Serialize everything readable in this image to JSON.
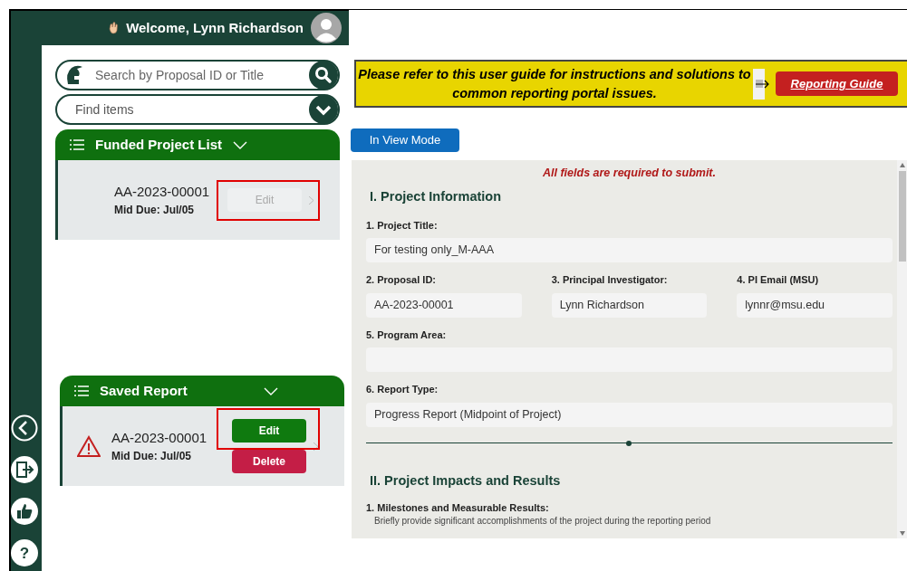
{
  "header": {
    "welcome": "Welcome, Lynn Richardson"
  },
  "search": {
    "placeholder": "Search by Proposal ID or Title"
  },
  "filter": {
    "placeholder": "Find items"
  },
  "funded_list": {
    "title": "Funded Project List",
    "items": [
      {
        "id": "AA-2023-00001",
        "due": "Mid Due: Jul/05",
        "warning": false,
        "highlighted": true,
        "buttons": [
          {
            "label": "Edit",
            "kind": "edit",
            "disabled": true
          }
        ]
      }
    ]
  },
  "saved_list": {
    "title": "Saved Report",
    "items": [
      {
        "id": "AA-2023-00001",
        "due": "Mid Due: Jul/05",
        "warning": true,
        "highlighted": true,
        "buttons": [
          {
            "label": "Edit",
            "kind": "edit",
            "disabled": false
          },
          {
            "label": "Delete",
            "kind": "delete",
            "disabled": false
          }
        ]
      }
    ]
  },
  "banner": {
    "text": "Please refer to this user guide for instructions and solutions to common reporting portal issues.",
    "button": "Reporting Guide"
  },
  "mode_button": "In View Mode",
  "sidebar": {
    "help_glyph": "?"
  },
  "form": {
    "notice": "All fields are required to submit.",
    "blocks": [
      {
        "kind": "heading",
        "text": "I. Project Information"
      },
      {
        "kind": "fields",
        "fields": [
          {
            "label": "1. Project Title:",
            "value": "For testing only_M-AAA"
          }
        ]
      },
      {
        "kind": "fields",
        "fields": [
          {
            "label": "2. Proposal ID:",
            "value": "AA-2023-00001"
          },
          {
            "label": "3. Principal Investigator:",
            "value": "Lynn Richardson"
          },
          {
            "label": "4. PI Email (MSU)",
            "value": "lynnr@msu.edu"
          }
        ]
      },
      {
        "kind": "fields",
        "fields": [
          {
            "label": "5. Program Area:"
          }
        ]
      },
      {
        "kind": "fields",
        "fields": [
          {
            "label": "6. Report Type:",
            "value": "Progress Report (Midpoint of Project)"
          }
        ]
      },
      {
        "kind": "divider"
      },
      {
        "kind": "heading",
        "text": "II. Project Impacts and Results"
      },
      {
        "kind": "question",
        "label": "1. Milestones and Measurable Results:",
        "hint": "Briefly provide significant accomplishments of the project during the reporting period"
      }
    ]
  }
}
